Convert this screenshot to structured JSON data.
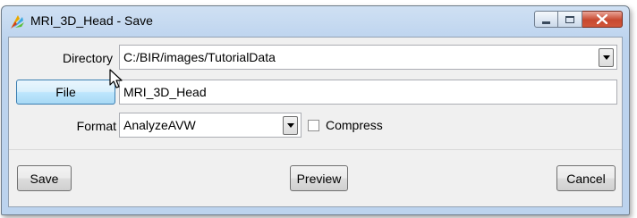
{
  "window": {
    "title": "MRI_3D_Head - Save",
    "buttons": [
      "minimize",
      "maximize",
      "close"
    ]
  },
  "form": {
    "directory_label": "Directory",
    "directory_value": "C:/BIR/images/TutorialData",
    "file_button_label": "File",
    "file_value": "MRI_3D_Head",
    "format_label": "Format",
    "format_value": "AnalyzeAVW",
    "compress_label": "Compress",
    "compress_checked": false
  },
  "actions": {
    "save_label": "Save",
    "preview_label": "Preview",
    "cancel_label": "Cancel"
  },
  "icons": {
    "app": "app-icon",
    "cursor": "mouse-pointer-icon"
  }
}
